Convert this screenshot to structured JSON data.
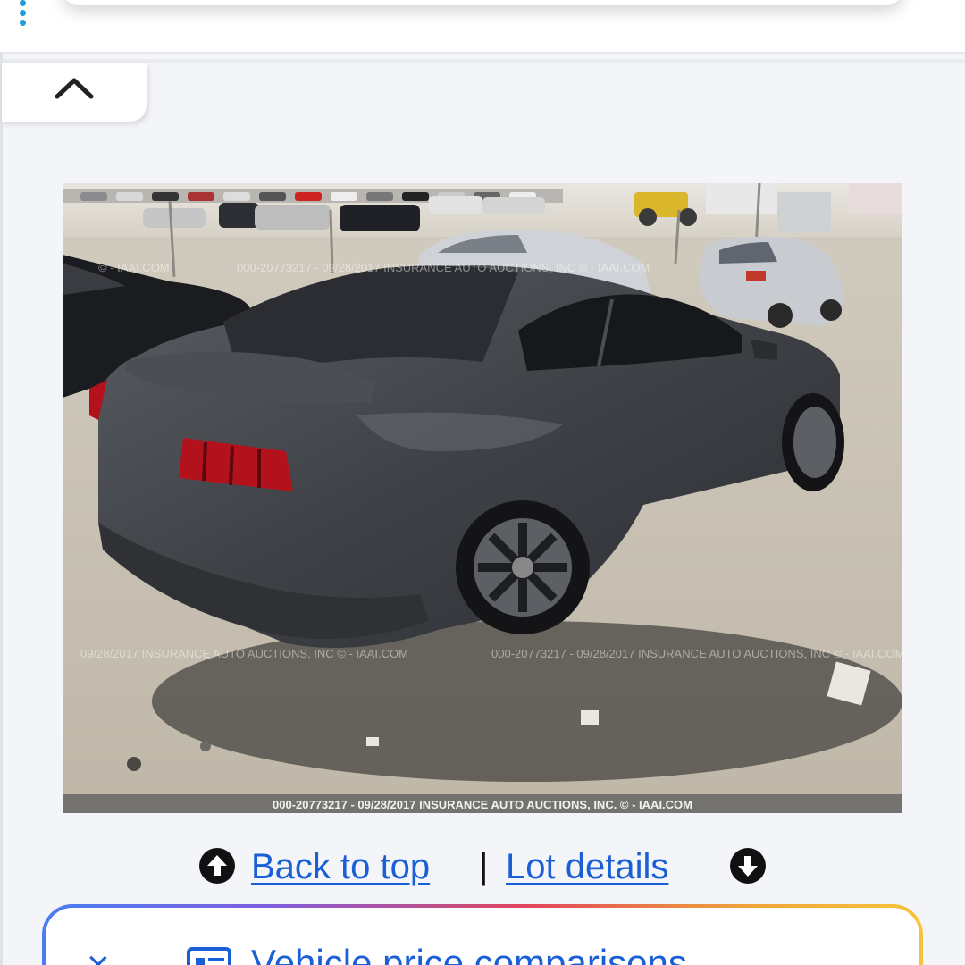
{
  "photo": {
    "watermark_top": "000-20773217 - 09/28/2017 INSURANCE AUTO AUCTIONS, INC © - IAAI.COM",
    "watermark_top_left": "© - IAAI.COM",
    "watermark_mid": "000-20773217 - 09/28/2017 INSURANCE AUTO AUCTIONS, INC © - IAAI.COM",
    "watermark_mid_left": "09/28/2017 INSURANCE AUTO AUCTIONS, INC © - IAAI.COM",
    "caption": "000-20773217 - 09/28/2017 INSURANCE AUTO AUCTIONS, INC. © - IAAI.COM"
  },
  "nav": {
    "back_to_top": "Back to top",
    "separator": "|",
    "lot_details": "Lot details"
  },
  "price_card": {
    "close": "×",
    "title": "Vehicle price comparisons"
  },
  "colors": {
    "link": "#1a5fd6",
    "dots": "#1a9fd8",
    "background": "#f3f5f9"
  },
  "icons": {
    "menu": "vertical-dots-icon",
    "collapse": "chevron-up-icon",
    "up": "arrow-up-circle-icon",
    "down": "arrow-down-circle-icon",
    "card": "list-icon"
  }
}
